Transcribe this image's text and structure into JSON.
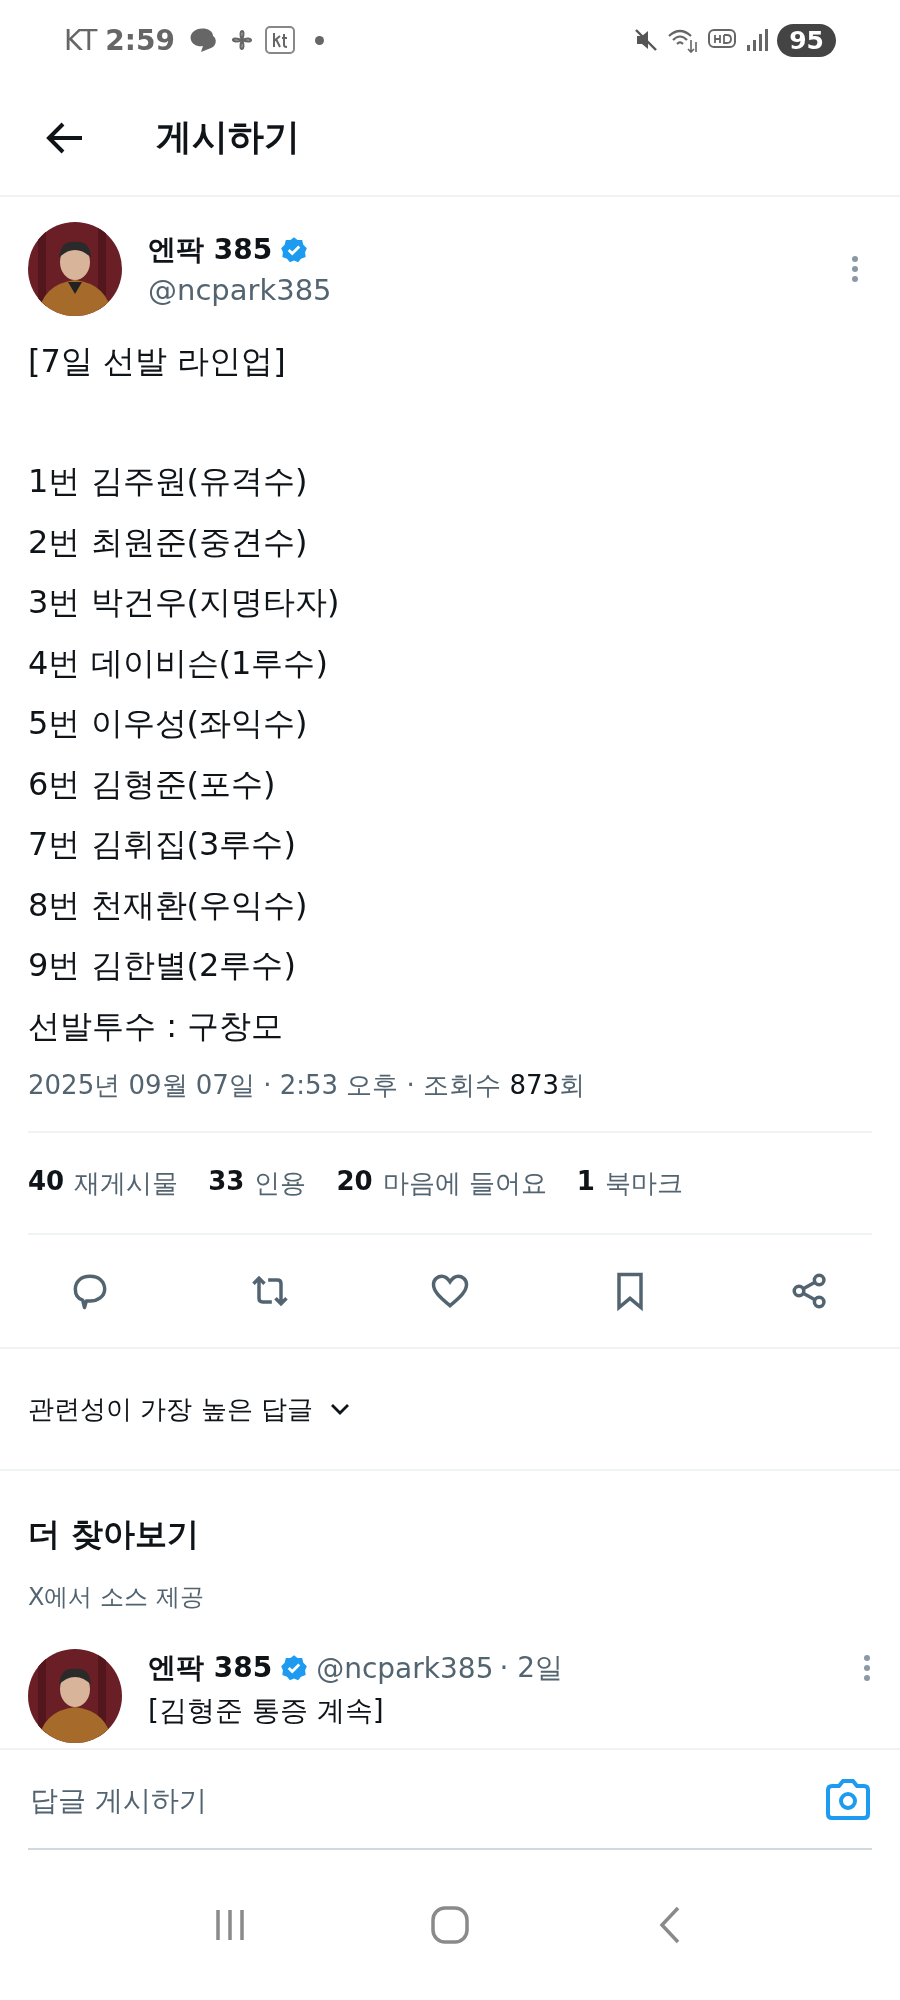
{
  "status_bar": {
    "carrier": "KT",
    "time": "2:59",
    "battery": "95"
  },
  "header": {
    "title": "게시하기"
  },
  "post": {
    "author": {
      "name": "엔팍 385",
      "handle": "@ncpark385",
      "verified": true
    },
    "title": "[7일 선발 라인업]",
    "lines": [
      "1번 김주원(유격수)",
      "2번 최원준(중견수)",
      "3번 박건우(지명타자)",
      "4번 데이비슨(1루수)",
      "5번 이우성(좌익수)",
      "6번 김형준(포수)",
      "7번 김휘집(3루수)",
      "8번 천재환(우익수)",
      "9번 김한별(2루수)",
      "선발투수 : 구창모"
    ],
    "meta": "2025년 09월 07일 · 2:53 오후 · 조회수 **873**회",
    "stats": [
      {
        "count": "40",
        "label": "재게시물"
      },
      {
        "count": "33",
        "label": "인용"
      },
      {
        "count": "20",
        "label": "마음에 들어요"
      },
      {
        "count": "1",
        "label": "북마크"
      }
    ]
  },
  "replies_sort": {
    "label": "관련성이 가장 높은 답글"
  },
  "explore": {
    "title": "더 찾아보기",
    "subtitle": "X에서 소스 제공",
    "posts": [
      {
        "name": "엔팍 385",
        "verified": true,
        "handle": "@ncpark385",
        "age": "· 2일",
        "text": "[김형준 통증 계속]"
      }
    ]
  },
  "reply_bar": {
    "placeholder": "답글 게시하기"
  }
}
